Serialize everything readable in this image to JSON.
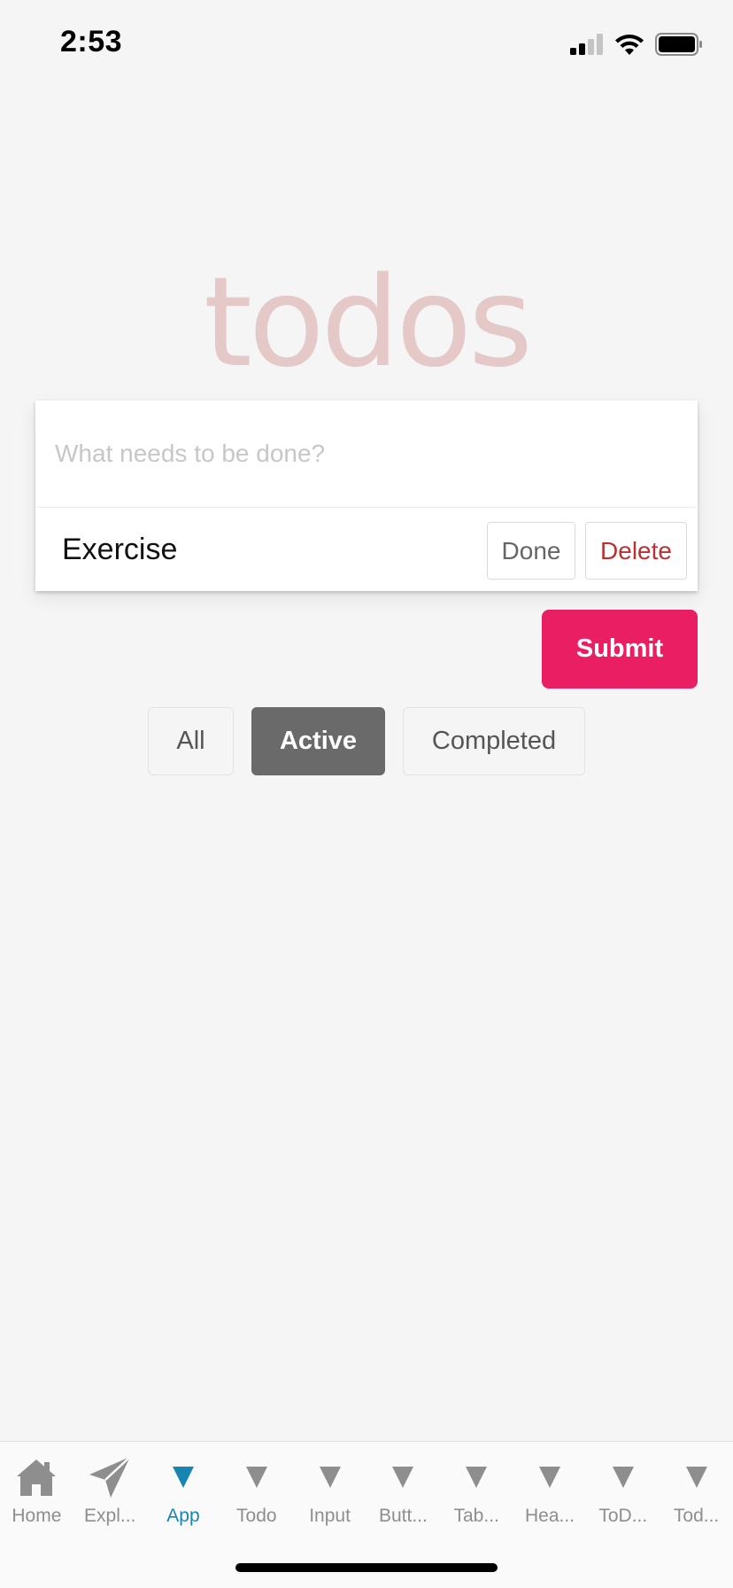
{
  "status_bar": {
    "time": "2:53"
  },
  "title": "todos",
  "new_todo": {
    "placeholder": "What needs to be done?"
  },
  "todos": [
    {
      "text": "Exercise",
      "done_label": "Done",
      "delete_label": "Delete"
    }
  ],
  "submit_label": "Submit",
  "filters": [
    {
      "label": "All",
      "selected": false
    },
    {
      "label": "Active",
      "selected": true
    },
    {
      "label": "Completed",
      "selected": false
    }
  ],
  "tab_bar": {
    "items": [
      {
        "label": "Home",
        "icon": "home-icon",
        "active": false
      },
      {
        "label": "Expl...",
        "icon": "paper-plane-icon",
        "active": false
      },
      {
        "label": "App",
        "icon": "triangle-down-icon",
        "active": true
      },
      {
        "label": "Todo",
        "icon": "triangle-down-icon",
        "active": false
      },
      {
        "label": "Input",
        "icon": "triangle-down-icon",
        "active": false
      },
      {
        "label": "Butt...",
        "icon": "triangle-down-icon",
        "active": false
      },
      {
        "label": "Tab...",
        "icon": "triangle-down-icon",
        "active": false
      },
      {
        "label": "Hea...",
        "icon": "triangle-down-icon",
        "active": false
      },
      {
        "label": "ToD...",
        "icon": "triangle-down-icon",
        "active": false
      },
      {
        "label": "Tod...",
        "icon": "triangle-down-icon",
        "active": false
      }
    ]
  },
  "colors": {
    "background": "#f5f5f5",
    "title": "#e6c9c9",
    "submit": "#ea1f63",
    "delete_text": "#b83232",
    "active_filter": "#6a6a6a",
    "tab_active": "#1686b0",
    "tab_inactive": "#8e8e8e"
  }
}
